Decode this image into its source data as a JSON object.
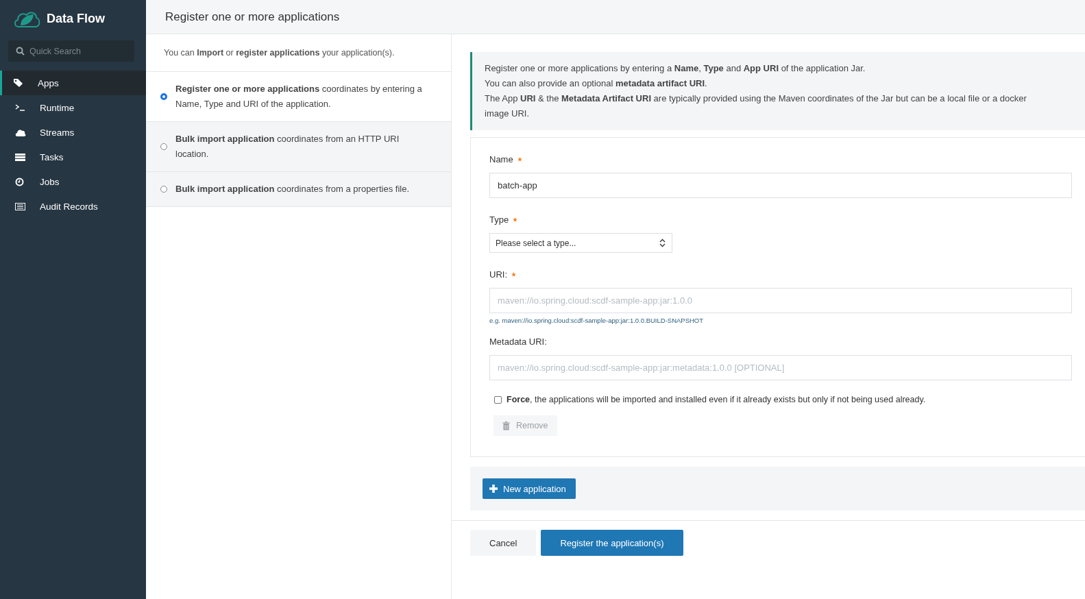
{
  "sidebar": {
    "brand": "Data Flow",
    "search": {
      "placeholder": "Quick Search"
    },
    "items": [
      {
        "label": "Apps",
        "selected": true
      },
      {
        "label": "Runtime",
        "selected": false
      },
      {
        "label": "Streams",
        "selected": false
      },
      {
        "label": "Tasks",
        "selected": false
      },
      {
        "label": "Jobs",
        "selected": false
      },
      {
        "label": "Audit Records",
        "selected": false
      }
    ]
  },
  "header": {
    "title": "Register one or more applications"
  },
  "intro": "You can **Import** or **register applications** your application(s).",
  "options": [
    {
      "text": "**Register one or more applications** coordinates by entering a Name, Type and URI of the application.",
      "selected": true
    },
    {
      "text": "**Bulk import application** coordinates from an HTTP URI location.",
      "selected": false
    },
    {
      "text": "**Bulk import application** coordinates from a properties file.",
      "selected": false
    }
  ],
  "info": [
    "Register one or more applications by entering a **Name**, **Type** and **App URI** of the application Jar.",
    "You can also provide an optional **metadata artifact URI**.",
    "The App **URI** & the **Metadata Artifact URI** are typically provided using the Maven coordinates of the Jar but can be a local file or a docker image URI."
  ],
  "form": {
    "fields": [
      {
        "kind": "text",
        "label": "Name",
        "required": true,
        "value": "batch-app"
      },
      {
        "kind": "select",
        "label": "Type",
        "required": true,
        "placeholder": "Please select a type..."
      },
      {
        "kind": "text",
        "label": "URI:",
        "required": true,
        "placeholder": "maven://io.spring.cloud:scdf-sample-app:jar:1.0.0",
        "hint": "e.g. maven://io.spring.cloud:scdf-sample-app:jar:1.0.0.BUILD-SNAPSHOT"
      },
      {
        "kind": "text",
        "label": "Metadata URI:",
        "required": false,
        "placeholder": "maven://io.spring.cloud:scdf-sample-app:jar:metadata:1.0.0 [OPTIONAL]"
      }
    ],
    "force": {
      "text": "**Force**, the applications will be imported and installed even if it already exists but only if not being used already.",
      "checked": false
    },
    "remove": {
      "label": "Remove",
      "disabled": true
    }
  },
  "new_button": "New application",
  "buttons": {
    "cancel": "Cancel",
    "submit": "Register the application(s)"
  }
}
